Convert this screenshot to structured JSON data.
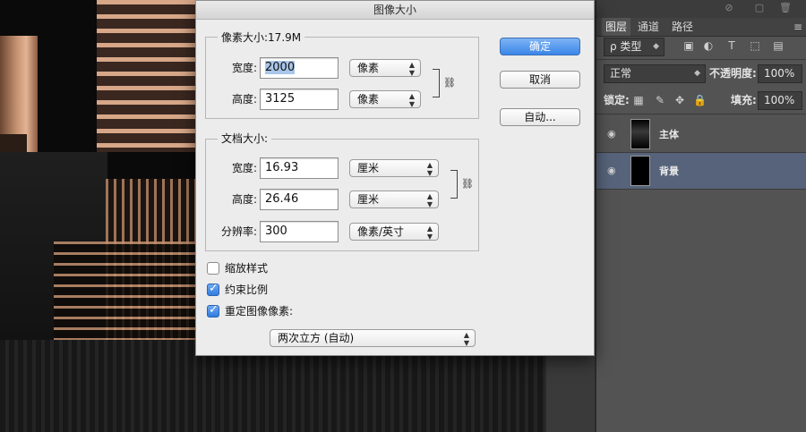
{
  "dialog": {
    "title": "图像大小",
    "pixel_dimensions": {
      "title": "像素大小:17.9M",
      "width_label": "宽度:",
      "width_value": "2000",
      "width_unit": "像素",
      "height_label": "高度:",
      "height_value": "3125",
      "height_unit": "像素"
    },
    "document_size": {
      "title": "文档大小:",
      "width_label": "宽度:",
      "width_value": "16.93",
      "width_unit": "厘米",
      "height_label": "高度:",
      "height_value": "26.46",
      "height_unit": "厘米",
      "resolution_label": "分辨率:",
      "resolution_value": "300",
      "resolution_unit": "像素/英寸"
    },
    "options": {
      "scale_styles": {
        "label": "缩放样式",
        "checked": false
      },
      "constrain_proportions": {
        "label": "约束比例",
        "checked": true
      },
      "resample": {
        "label": "重定图像像素:",
        "checked": true
      },
      "resample_method": "两次立方 (自动)"
    },
    "buttons": {
      "ok": "确定",
      "cancel": "取消",
      "auto": "自动..."
    }
  },
  "layers_panel": {
    "tabs": [
      "图层",
      "通道",
      "路径"
    ],
    "active_tab": 0,
    "filter_kind": "ρ 类型",
    "blend_mode": "正常",
    "opacity_label": "不透明度:",
    "opacity_value": "100%",
    "lock_label": "锁定:",
    "fill_label": "填充:",
    "fill_value": "100%",
    "layers": [
      {
        "name": "主体",
        "visible": true,
        "selected": false
      },
      {
        "name": "背景",
        "visible": true,
        "selected": true
      }
    ]
  },
  "colors": {
    "accent": "#3a86e8",
    "selected_layer": "#56637a",
    "panel_bg": "#535353"
  }
}
